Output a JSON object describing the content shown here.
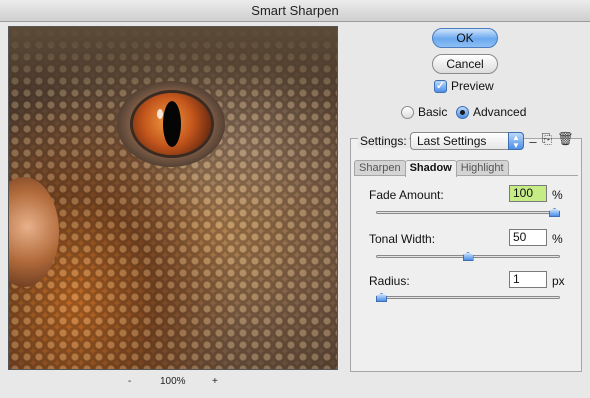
{
  "window": {
    "title": "Smart Sharpen"
  },
  "preview": {
    "zoom": "100%",
    "zoom_out": "-",
    "zoom_in": "+"
  },
  "buttons": {
    "ok": "OK",
    "cancel": "Cancel"
  },
  "options": {
    "preview_label": "Preview",
    "preview_checked": true,
    "mode": {
      "basic": "Basic",
      "advanced": "Advanced",
      "selected": "Advanced"
    }
  },
  "settings": {
    "label": "Settings:",
    "value": "Last Settings"
  },
  "tabs": [
    {
      "label": "Sharpen",
      "active": false
    },
    {
      "label": "Shadow",
      "active": true
    },
    {
      "label": "Highlight",
      "active": false
    }
  ],
  "shadow": {
    "fade_amount": {
      "label": "Fade Amount:",
      "value": "100",
      "unit": "%",
      "level": 1.0
    },
    "tonal_width": {
      "label": "Tonal Width:",
      "value": "50",
      "unit": "%",
      "level": 0.5
    },
    "radius": {
      "label": "Radius:",
      "value": "1",
      "unit": "px",
      "level": 0.0
    }
  }
}
